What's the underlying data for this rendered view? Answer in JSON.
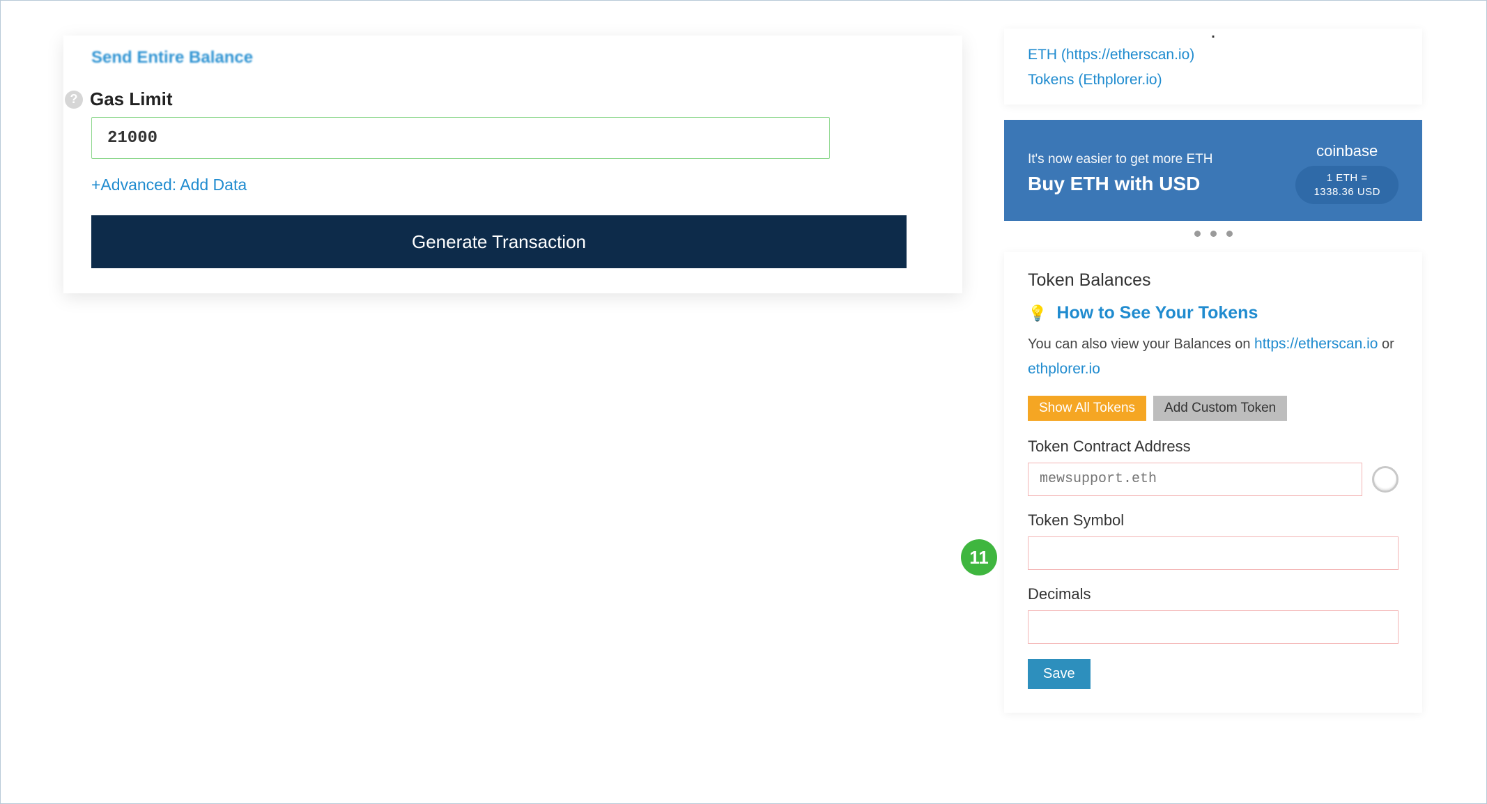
{
  "left": {
    "send_entire": "Send Entire Balance",
    "gas_label": "Gas Limit",
    "gas_value": "21000",
    "advanced_link": "+Advanced: Add Data",
    "generate_btn": "Generate Transaction"
  },
  "history": {
    "eth_link": "ETH (https://etherscan.io)",
    "tokens_link": "Tokens (Ethplorer.io)"
  },
  "promo": {
    "tagline": "It's now easier to get more ETH",
    "headline": "Buy ETH with USD",
    "brand": "coinbase",
    "rate_line1": "1 ETH =",
    "rate_line2": "1338.36 USD"
  },
  "tokens": {
    "title": "Token Balances",
    "howto": "How to See Your Tokens",
    "desc_prefix": "You can also view your Balances on ",
    "desc_link1": "https://etherscan.io",
    "desc_mid": " or ",
    "desc_link2": "ethplorer.io",
    "show_all_btn": "Show All Tokens",
    "add_custom_btn": "Add Custom Token",
    "addr_label": "Token Contract Address",
    "addr_placeholder": "mewsupport.eth",
    "symbol_label": "Token Symbol",
    "decimals_label": "Decimals",
    "save_btn": "Save"
  },
  "annotation": {
    "badge": "11"
  },
  "icons": {
    "help": "?",
    "bulb": "💡"
  }
}
